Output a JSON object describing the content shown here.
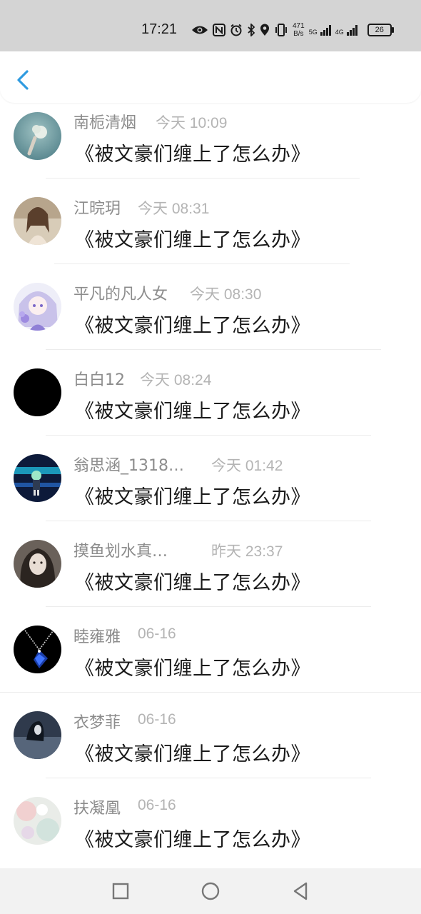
{
  "status_bar": {
    "time": "17:21",
    "net_speed_value": "471",
    "net_speed_unit": "B/s",
    "sim1_label": "5G",
    "sim2_label": "4G",
    "battery": "26"
  },
  "header": {
    "back_icon": "chevron-left-icon",
    "accent_color": "#2f9be0"
  },
  "comments": [
    {
      "name": "南栀清烟",
      "time": "今天 10:09",
      "text": "《被文豪们缠上了怎么办》"
    },
    {
      "name": "江晥玥",
      "time": "今天 08:31",
      "text": "《被文豪们缠上了怎么办》"
    },
    {
      "name": "平凡的凡人女",
      "time": "今天 08:30",
      "text": "《被文豪们缠上了怎么办》"
    },
    {
      "name": "白白12",
      "time": "今天 08:24",
      "text": "《被文豪们缠上了怎么办》"
    },
    {
      "name": "翁思涵_1318…",
      "time": "今天 01:42",
      "text": "《被文豪们缠上了怎么办》"
    },
    {
      "name": "摸鱼划水真…",
      "time": "昨天 23:37",
      "text": "《被文豪们缠上了怎么办》"
    },
    {
      "name": "睦雍雅",
      "time": "06-16",
      "text": "《被文豪们缠上了怎么办》"
    },
    {
      "name": "衣梦菲",
      "time": "06-16",
      "text": "《被文豪们缠上了怎么办》"
    },
    {
      "name": "扶凝凰",
      "time": "06-16",
      "text": "《被文豪们缠上了怎么办》"
    }
  ],
  "nav_bar": {
    "recent_icon": "square-icon",
    "home_icon": "circle-icon",
    "back_icon": "triangle-back-icon"
  }
}
